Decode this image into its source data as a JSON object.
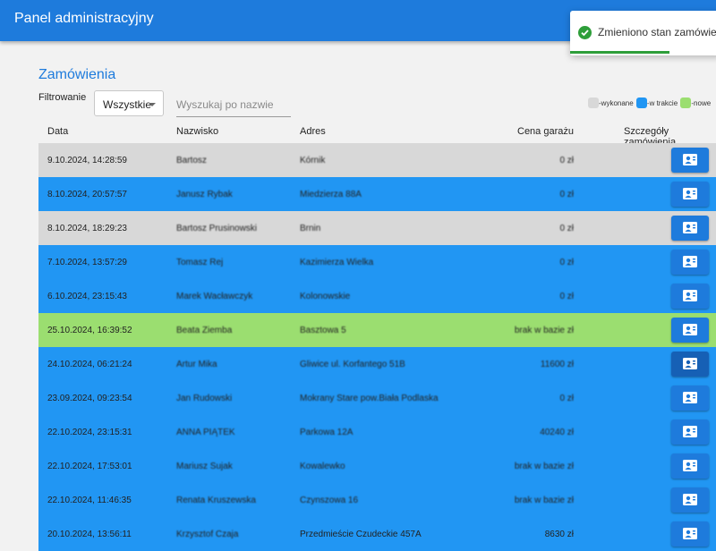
{
  "header": {
    "title": "Panel administracyjny"
  },
  "page": {
    "title": "Zamówienia",
    "filter_label": "Filtrowanie",
    "filter_value": "Wszystkie",
    "search_placeholder": "Wyszukaj po nazwie"
  },
  "legend": {
    "done": "-wykonane",
    "in_progress": "-w trakcie",
    "new": "-nowe"
  },
  "colors": {
    "done": "#d8d8d8",
    "in_progress": "#2196f3",
    "new": "#9bde70",
    "accent": "#1e7bdc"
  },
  "table": {
    "columns": {
      "date": "Data",
      "name": "Nazwisko",
      "address": "Adres",
      "price": "Cena garażu",
      "details": "Szczegóły zamówienia"
    },
    "rows": [
      {
        "date": "9.10.2024, 14:28:59",
        "name": "Bartosz",
        "address": "Kórnik",
        "price": "0 zł",
        "status": "done"
      },
      {
        "date": "8.10.2024, 20:57:57",
        "name": "Janusz Rybak",
        "address": "Miedzierza 88A",
        "price": "0 zł",
        "status": "in_progress"
      },
      {
        "date": "8.10.2024, 18:29:23",
        "name": "Bartosz Prusinowski",
        "address": "Brnin",
        "price": "0 zł",
        "status": "done"
      },
      {
        "date": "7.10.2024, 13:57:29",
        "name": "Tomasz Rej",
        "address": "Kazimierza Wielka",
        "price": "0 zł",
        "status": "in_progress"
      },
      {
        "date": "6.10.2024, 23:15:43",
        "name": "Marek Wacławczyk",
        "address": "Kolonowskie",
        "price": "0 zł",
        "status": "in_progress"
      },
      {
        "date": "25.10.2024, 16:39:52",
        "name": "Beata Ziemba",
        "address": "Basztowa 5",
        "price": "brak w bazie zł",
        "status": "new"
      },
      {
        "date": "24.10.2024, 06:21:24",
        "name": "Artur Mika",
        "address": "Gliwice ul. Korfantego 51B",
        "price": "11600 zł",
        "status": "in_progress"
      },
      {
        "date": "23.09.2024, 09:23:54",
        "name": "Jan Rudowski",
        "address": "Mokrany Stare pow.Biała Podlaska",
        "price": "0 zł",
        "status": "in_progress"
      },
      {
        "date": "22.10.2024, 23:15:31",
        "name": "ANNA PIĄTEK",
        "address": "Parkowa 12A",
        "price": "40240 zł",
        "status": "in_progress"
      },
      {
        "date": "22.10.2024, 17:53:01",
        "name": "Mariusz Sujak",
        "address": "Kowalewko",
        "price": "brak w bazie zł",
        "status": "in_progress"
      },
      {
        "date": "22.10.2024, 11:46:35",
        "name": "Renata Kruszewska",
        "address": "Czynszowa 16",
        "price": "brak w bazie zł",
        "status": "in_progress"
      },
      {
        "date": "20.10.2024, 13:56:11",
        "name": "Krzysztof Czaja",
        "address": "Przedmieście Czudeckie 457A",
        "price": "8630 zł",
        "status": "in_progress"
      }
    ]
  },
  "toast": {
    "message": "Zmieniono stan zamówienia",
    "progress": 0.65
  }
}
